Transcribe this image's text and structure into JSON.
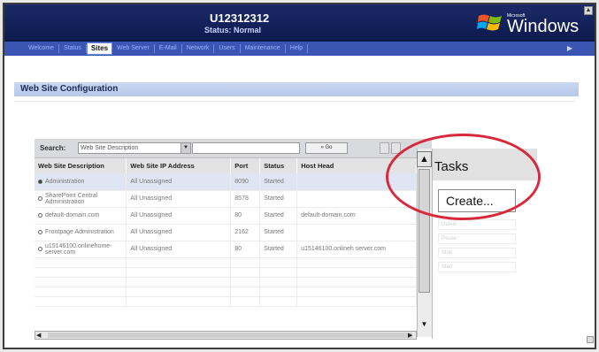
{
  "header": {
    "server_name": "U12312312",
    "status": "Status: Normal",
    "windows_label": "Windows",
    "windows_super": "Microsoft"
  },
  "nav": {
    "items": [
      "Welcome",
      "Status",
      "Sites",
      "Web Server",
      "E-Mail",
      "Network",
      "Users",
      "Maintenance",
      "Help"
    ],
    "active": "Sites"
  },
  "section": {
    "title": "Web Site Configuration"
  },
  "search": {
    "label": "Search:",
    "field_value": "Web Site Description",
    "query": "",
    "go_label": "» Go"
  },
  "table": {
    "columns": [
      "Web Site Description",
      "Web Site IP Address",
      "Port",
      "Status",
      "Host Head"
    ],
    "rows": [
      {
        "selected": true,
        "description": "Administration",
        "ip": "All Unassigned",
        "port": "8090",
        "status": "Started",
        "host": ""
      },
      {
        "selected": false,
        "description": "SharePoint Central Administration",
        "ip": "All Unassigned",
        "port": "8578",
        "status": "Started",
        "host": ""
      },
      {
        "selected": false,
        "description": "default-domain.com",
        "ip": "All Unassigned",
        "port": "80",
        "status": "Started",
        "host": "default-domain.com"
      },
      {
        "selected": false,
        "description": "Frontpage Administration",
        "ip": "All Unassigned",
        "port": "2162",
        "status": "Started",
        "host": ""
      },
      {
        "selected": false,
        "description": "u15146100.onlinehome-server.com",
        "ip": "All Unassigned",
        "port": "80",
        "status": "Started",
        "host": "u15146100.onlineh server.com"
      }
    ]
  },
  "tasks": {
    "title": "Tasks",
    "create_label": "Create...",
    "other_items": [
      "Delete",
      "Pause",
      "Stop",
      "Start"
    ]
  },
  "colors": {
    "header_bg": "#13225c",
    "nav_bg": "#3a55b2",
    "section_bg": "#c2d2f0",
    "highlight": "#d8283b"
  }
}
